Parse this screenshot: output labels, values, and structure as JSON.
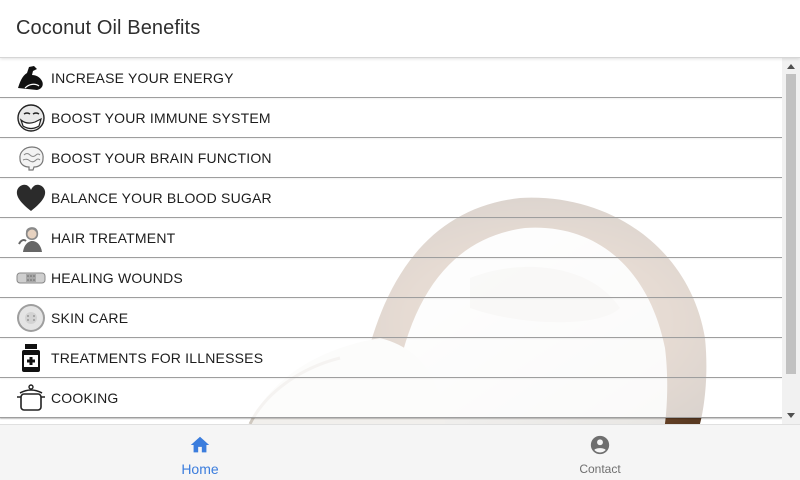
{
  "header": {
    "title": "Coconut Oil Benefits"
  },
  "list": {
    "items": [
      {
        "label": "INCREASE YOUR ENERGY",
        "icon": "flexed-arm-icon"
      },
      {
        "label": "BOOST YOUR IMMUNE SYSTEM",
        "icon": "sneezing-face-icon"
      },
      {
        "label": "BOOST YOUR BRAIN FUNCTION",
        "icon": "brain-icon"
      },
      {
        "label": "BALANCE YOUR BLOOD SUGAR",
        "icon": "heart-icon"
      },
      {
        "label": "HAIR TREATMENT",
        "icon": "hair-person-icon"
      },
      {
        "label": "HEALING WOUNDS",
        "icon": "bandage-icon"
      },
      {
        "label": "SKIN CARE",
        "icon": "cucumber-slice-icon"
      },
      {
        "label": "TREATMENTS FOR ILLNESSES",
        "icon": "medicine-bottle-icon"
      },
      {
        "label": "COOKING",
        "icon": "cooking-pot-icon"
      }
    ]
  },
  "bottom_nav": {
    "home": {
      "label": "Home",
      "icon": "home-icon",
      "color": "#3b7ddd"
    },
    "contact": {
      "label": "Contact",
      "icon": "account-circle-icon",
      "color": "#6f6f6f"
    }
  },
  "colors": {
    "background_image": "coconut",
    "scrollbar_thumb": "#c1c1c1"
  }
}
